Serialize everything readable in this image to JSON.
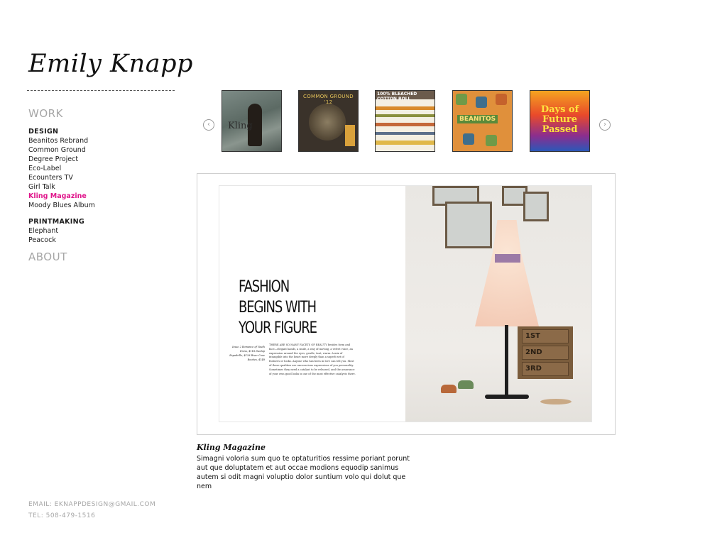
{
  "site": {
    "logo_text": "Emily Knapp"
  },
  "nav": {
    "work_label": "WORK",
    "design": {
      "heading": "DESIGN",
      "items": [
        "Beanitos Rebrand",
        "Common Ground",
        "Degree Project",
        "Eco-Label",
        "Ecounters TV",
        "Girl Talk",
        "Kling Magazine",
        "Moody Blues Album"
      ],
      "active": "Kling Magazine"
    },
    "printmaking": {
      "heading": "PRINTMAKING",
      "items": [
        "Elephant",
        "Peacock"
      ]
    },
    "about_label": "ABOUT"
  },
  "contact": {
    "email_line": "EMAIL: EKNAPPDESIGN@GMAIL.COM",
    "tel_line": "TEL: 508-479-1516"
  },
  "carousel": {
    "prev_icon": "‹",
    "next_icon": "›",
    "thumbnails": [
      {
        "name": "kling",
        "text": "Kling"
      },
      {
        "name": "common-ground",
        "text": "COMMON GROUND '12"
      },
      {
        "name": "degree-project",
        "text": "100% BLEACHED COTTON BOLL"
      },
      {
        "name": "beanitos",
        "text": "BEANITOS"
      },
      {
        "name": "moody-blues",
        "text": "Days of Future Passed"
      }
    ]
  },
  "feature": {
    "headline_lines": [
      "FASHION",
      "BEGINS WITH",
      "YOUR FIGURE"
    ],
    "credits": "Issue 2 Romance of Youth Dress, $118 Dunlap Espadrille, $128 River Cove Booties, $148",
    "body": "THERE ARE SO MANY FACETS OF BEAUTY besides form and face—elegant hands, a smile, a way of moving, a velvet voice, an expression around the eyes, gentle, taut, warm. A mix of intangible into the heart more deeply than a superb set of features or looks. Anyone who has been in love can tell you. Most of these qualities are unconscious expressions of you personality. Sometimes they need a catalyst to be released, and the assurance of your own good looks is one of the most effective catalysts there.",
    "drawer_labels": [
      "1ST",
      "2ND",
      "3RD"
    ]
  },
  "caption": {
    "title": "Kling Magazine",
    "text": "Simagni voloria sum quo te optaturitios ressime poriant porunt aut que doluptatem et aut occae modions equodip sanimus autem si odit magni voluptio dolor suntium volo qui dolut que nem"
  },
  "colors": {
    "accent": "#e0168b",
    "muted": "#a6a6a6"
  }
}
